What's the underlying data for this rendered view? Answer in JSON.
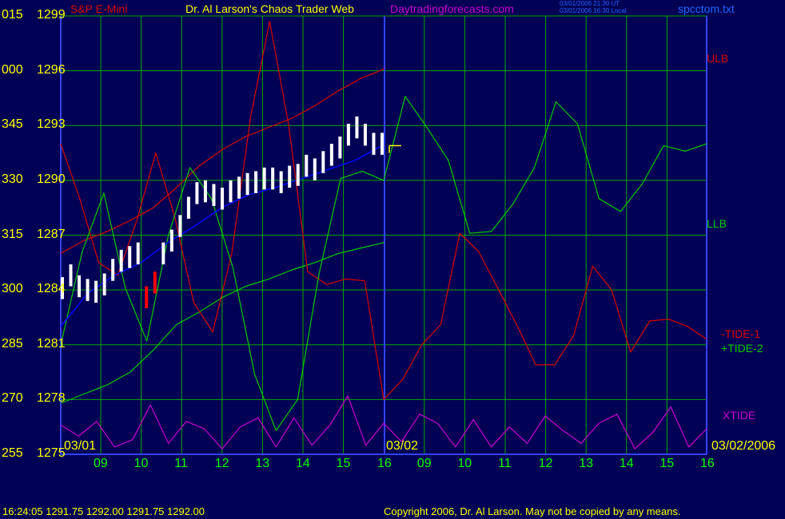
{
  "header": {
    "symbol": "S&P E-Mini",
    "title": "Dr. Al Larson's Chaos Trader Web",
    "site": "Daytradingforecasts.com",
    "stamp1": "03/01/2006 21:30 UT",
    "stamp2": "03/01/2006 16:30 Local",
    "file": "spcctom.txt"
  },
  "colors": {
    "background": "#000055",
    "grid": "#00aa00",
    "price_bar": "#ffffff",
    "price_low": "#ff0000",
    "moving_avg": "#0000ff",
    "red_line": "#dd0000",
    "green_line": "#00cc00",
    "xtide": "#cc00cc",
    "axis_text": "#ffff00",
    "time_text": "#00ff00"
  },
  "chart_data": {
    "type": "line",
    "y_axis": {
      "angle_labels": [
        "015",
        "000",
        "345",
        "330",
        "315",
        "300",
        "285",
        "270",
        "255"
      ],
      "price_labels": [
        "1299",
        "1296",
        "1293",
        "1290",
        "1287",
        "1284",
        "1281",
        "1278",
        "1275"
      ],
      "ylim": [
        1275,
        1299
      ]
    },
    "x_axis": {
      "hour_labels": [
        "09",
        "10",
        "11",
        "12",
        "13",
        "14",
        "15",
        "16",
        "09",
        "10",
        "11",
        "12",
        "13",
        "14",
        "15",
        "16"
      ],
      "date_labels": [
        "03/01",
        "03/02",
        "03/02/2006"
      ]
    },
    "right_labels": [
      {
        "text": "ULB",
        "color": "#dd0000"
      },
      {
        "text": "LLB",
        "color": "#00cc00"
      },
      {
        "text": "-TIDE-1",
        "color": "#dd0000"
      },
      {
        "text": "+TIDE-2",
        "color": "#00cc00"
      },
      {
        "text": "XTIDE",
        "color": "#cc00cc"
      }
    ],
    "series": [
      {
        "name": "ULB",
        "values": [
          1286,
          1286.7,
          1287.2,
          1287.8,
          1288.5,
          1289.6,
          1290.8,
          1291.7,
          1292.4,
          1292.9,
          1293.4,
          1294.1,
          1294.9,
          1295.6,
          1296.1
        ]
      },
      {
        "name": "LLB",
        "values": [
          1277.8,
          1278.3,
          1278.8,
          1279.5,
          1280.7,
          1282.1,
          1282.8,
          1283.6,
          1284.2,
          1284.6,
          1285.1,
          1285.5,
          1286.0,
          1286.3,
          1286.6
        ]
      },
      {
        "name": "-TIDE-1",
        "values": [
          1292,
          1289,
          1285.5,
          1284.8,
          1287.8,
          1291.5,
          1288,
          1283.3,
          1281.7,
          1286,
          1293.5,
          1298.7,
          1293,
          1285,
          1284.3,
          1284.6,
          1284.5,
          1278,
          1279.1,
          1281,
          1282.1,
          1287.1,
          1286.1,
          1284.1,
          1282.1,
          1279.9,
          1279.9,
          1281.5,
          1285.3,
          1284,
          1280.6,
          1282.3,
          1282.4,
          1282,
          1281.3
        ]
      },
      {
        "name": "+TIDE-2",
        "values": [
          1281,
          1286.1,
          1289.3,
          1284.1,
          1281.2,
          1287,
          1290.7,
          1289,
          1285.2,
          1279.4,
          1276.3,
          1278,
          1284.9,
          1290.1,
          1290.5,
          1290,
          1294.6,
          1292.9,
          1291.1,
          1287.1,
          1287.2,
          1288.7,
          1290.7,
          1294.3,
          1293.1,
          1289,
          1288.3,
          1289.8,
          1291.9,
          1291.6,
          1292
        ]
      },
      {
        "name": "XTIDE",
        "values": [
          1276.6,
          1276,
          1276.8,
          1275.4,
          1275.8,
          1277.7,
          1275.6,
          1276.8,
          1276.4,
          1275.3,
          1276.5,
          1277,
          1275.4,
          1277,
          1275.5,
          1276.6,
          1278.2,
          1275.5,
          1276.7,
          1275.7,
          1277.2,
          1276.7,
          1275.4,
          1276.9,
          1275.4,
          1276.5,
          1275.6,
          1277.1,
          1276.3,
          1275.6,
          1276.7,
          1277.2,
          1275.3,
          1276.2,
          1277.6,
          1275.4,
          1276.4
        ]
      },
      {
        "name": "Price",
        "values": [
          1284.1,
          1284.8,
          1284.2,
          1284.0,
          1283.9,
          1284.3,
          1285.1,
          1285.6,
          1285.8,
          1286.0,
          1283.6,
          1284.4,
          1286.0,
          1286.7,
          1287.5,
          1288.5,
          1289.3,
          1289.4,
          1289.2,
          1289.0,
          1289.4,
          1289.6,
          1289.8,
          1289.9,
          1290.1,
          1290.1,
          1289.9,
          1290.2,
          1290.3,
          1290.8,
          1290.6,
          1291.0,
          1291.4,
          1291.8,
          1292.5,
          1292.9,
          1292.5,
          1292.0,
          1292.0
        ]
      },
      {
        "name": "MovingAvg",
        "values": [
          1282,
          1283.8,
          1284.8,
          1285.5,
          1286.6,
          1287.5,
          1288.5,
          1289.2,
          1289.6,
          1290.1,
          1290.6,
          1291.1,
          1291.9
        ]
      }
    ]
  },
  "footer": {
    "quote": "16:24:05   1291.75  1292.00  1291.75  1292.00",
    "copyright": "Copyright 2006, Dr. Al Larson. May not be copied by any means."
  }
}
